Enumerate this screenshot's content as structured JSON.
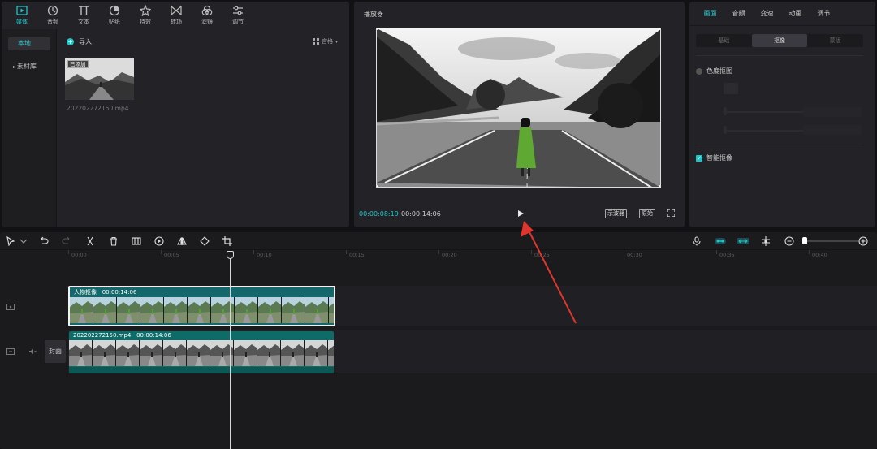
{
  "media_panel": {
    "tools": [
      {
        "label": "媒体",
        "icon": "media-icon",
        "active": true
      },
      {
        "label": "音频",
        "icon": "audio-icon",
        "active": false
      },
      {
        "label": "文本",
        "icon": "text-icon",
        "active": false
      },
      {
        "label": "贴纸",
        "icon": "sticker-icon",
        "active": false
      },
      {
        "label": "特效",
        "icon": "effects-icon",
        "active": false
      },
      {
        "label": "转场",
        "icon": "transition-icon",
        "active": false
      },
      {
        "label": "滤镜",
        "icon": "filter-icon",
        "active": false
      },
      {
        "label": "调节",
        "icon": "adjust-icon",
        "active": false
      }
    ],
    "side_items": [
      {
        "label": "本地",
        "active": true
      },
      {
        "label": "素材库",
        "active": false
      }
    ],
    "import_label": "导入",
    "sort_label": "宫格",
    "file": {
      "name": "202202272150.mp4",
      "badge": "已添加"
    }
  },
  "player": {
    "title": "播放器",
    "current_time": "00:00:08:19",
    "total_time": "00:00:14:06",
    "btn_reference": "示波器",
    "btn_original": "原始"
  },
  "properties": {
    "tabs": [
      {
        "label": "画面",
        "active": true
      },
      {
        "label": "音频",
        "active": false
      },
      {
        "label": "变速",
        "active": false
      },
      {
        "label": "动画",
        "active": false
      },
      {
        "label": "调节",
        "active": false
      }
    ],
    "subtabs": [
      {
        "label": "基础",
        "active": false
      },
      {
        "label": "抠像",
        "active": true
      },
      {
        "label": "蒙版",
        "active": false
      }
    ],
    "chroma_key_label": "色度抠图",
    "smart_cutout_label": "智能抠像"
  },
  "timeline": {
    "ruler_labels": [
      "00:00",
      "00:05",
      "00:10",
      "00:15",
      "00:20",
      "00:25",
      "00:30",
      "00:35",
      "00:40"
    ],
    "clip_top": {
      "name": "人物抠像",
      "duration": "00:00:14:06"
    },
    "clip_main": {
      "name": "202202272150.mp4",
      "duration": "00:00:14:06"
    },
    "cover_label": "封面"
  },
  "colors": {
    "accent": "#20c5c9",
    "clip_main": "#0e6b68",
    "panel": "#232327",
    "arrow": "#e0352d"
  }
}
